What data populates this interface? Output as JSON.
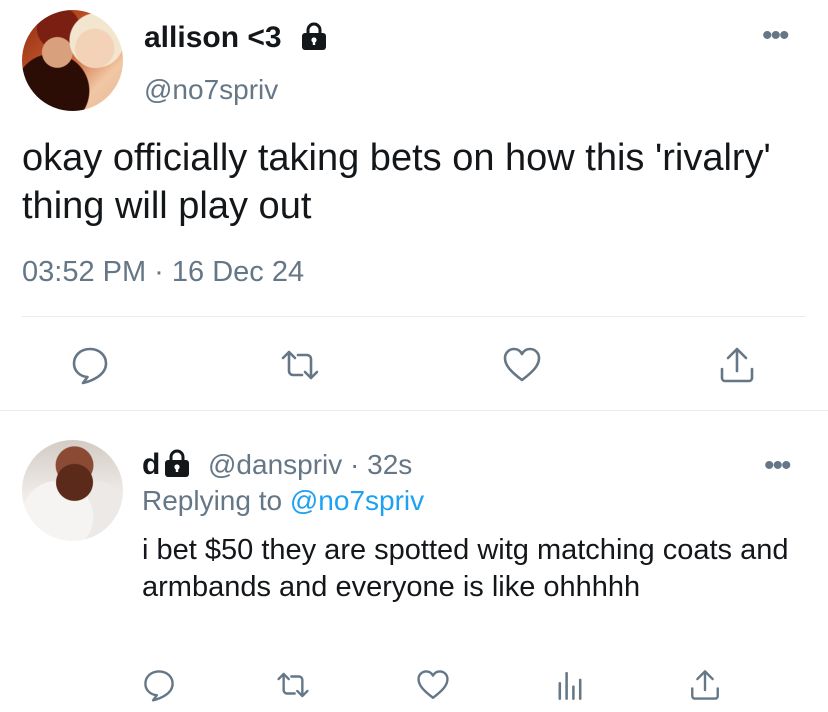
{
  "main_tweet": {
    "display_name": "allison <3",
    "handle": "@no7spriv",
    "text": "okay officially taking bets on how this 'rivalry' thing will play out",
    "timestamp": "03:52 PM · 16 Dec 24",
    "more_glyph": "•••"
  },
  "reply_tweet": {
    "display_name": "d",
    "meta": "@danspriv · 32s",
    "replying_prefix": "Replying to ",
    "replying_to": "@no7spriv",
    "text": "i bet $50 they are spotted witg matching coats and armbands and everyone is like ohhhhh",
    "more_glyph": "•••"
  },
  "icons": {
    "lock": "lock-icon",
    "reply": "reply-icon",
    "retweet": "retweet-icon",
    "like": "heart-icon",
    "share": "share-icon",
    "stats": "stats-icon",
    "more": "more-icon"
  },
  "colors": {
    "text": "#14171a",
    "secondary": "#657786",
    "link": "#1da1f2",
    "divider": "#e6ecf0"
  }
}
